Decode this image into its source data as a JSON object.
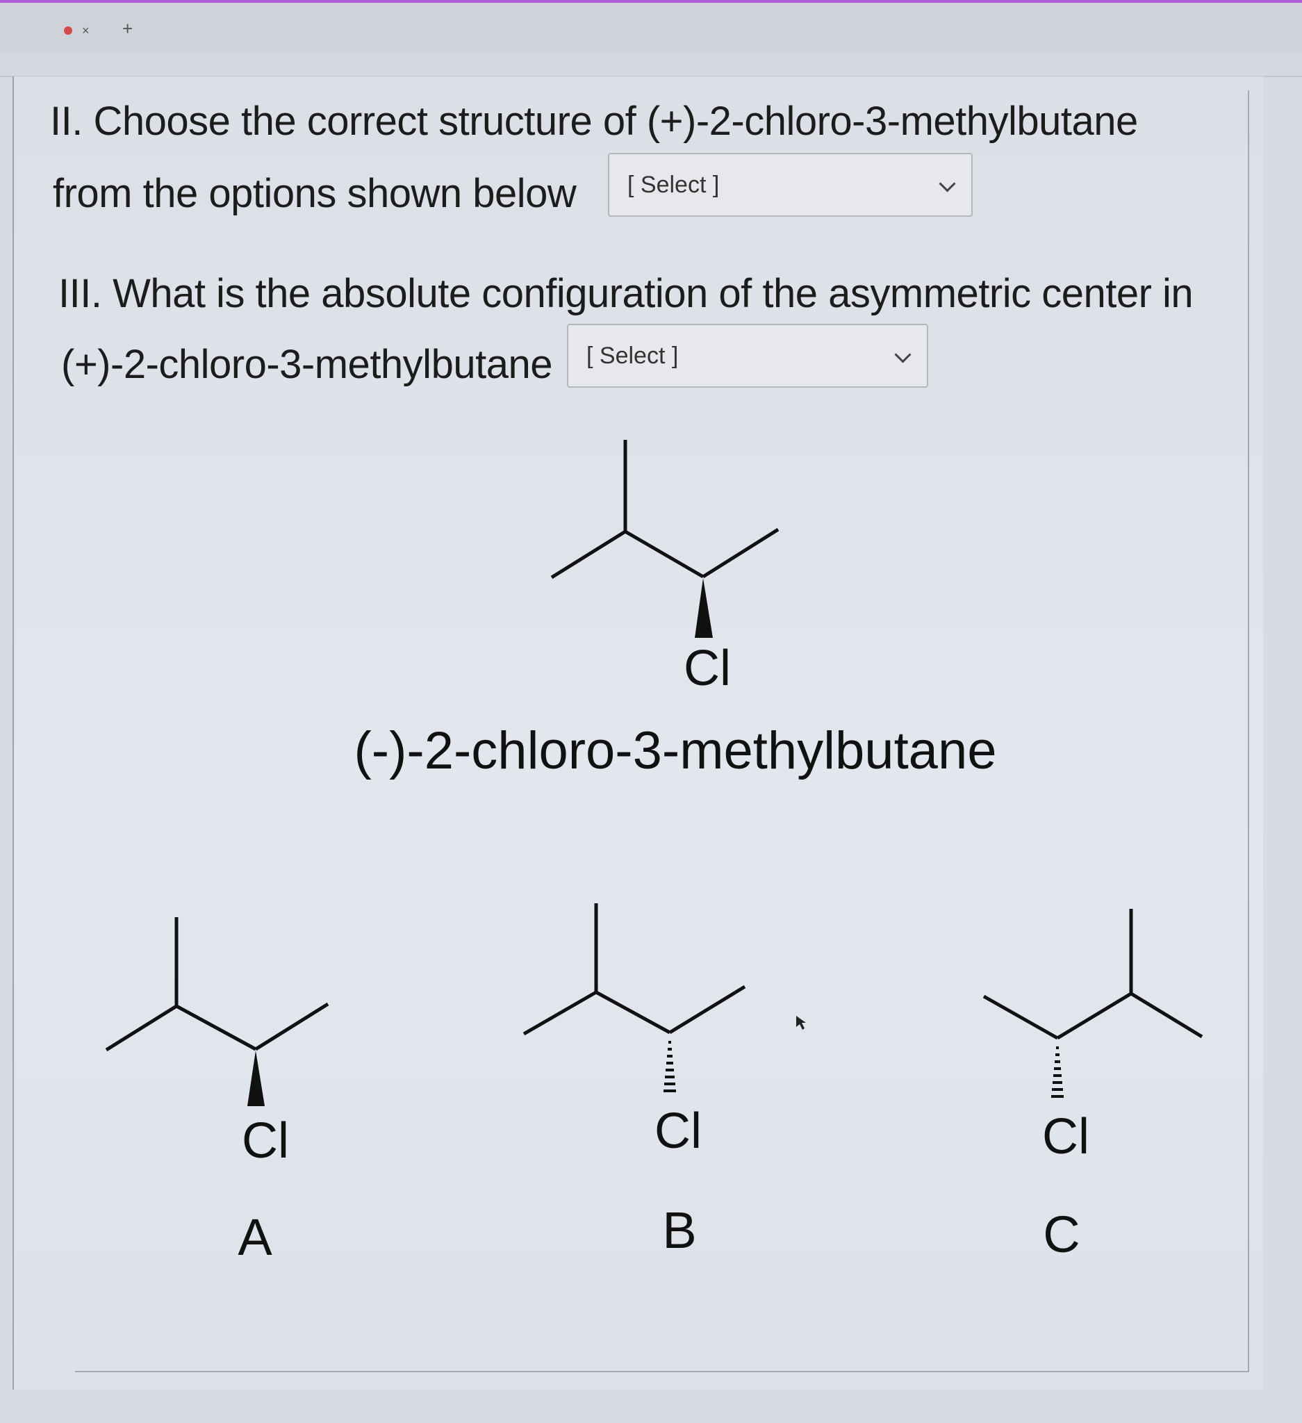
{
  "browser": {
    "tab_close": "×",
    "new_tab": "+"
  },
  "question2": {
    "line1": "II. Choose the correct structure of (+)-2-chloro-3-methylbutane",
    "line2": "from the options shown below",
    "select_value": "[ Select ]"
  },
  "question3": {
    "line1": "III. What is the absolute configuration of the asymmetric center in",
    "line2": "(+)-2-chloro-3-methylbutane",
    "select_value": "[ Select ]"
  },
  "figure": {
    "reference_atom": "Cl",
    "reference_caption": "(-)-2-chloro-3-methylbutane",
    "options": [
      {
        "atom": "Cl",
        "label": "A"
      },
      {
        "atom": "Cl",
        "label": "B"
      },
      {
        "atom": "Cl",
        "label": "C"
      }
    ]
  }
}
